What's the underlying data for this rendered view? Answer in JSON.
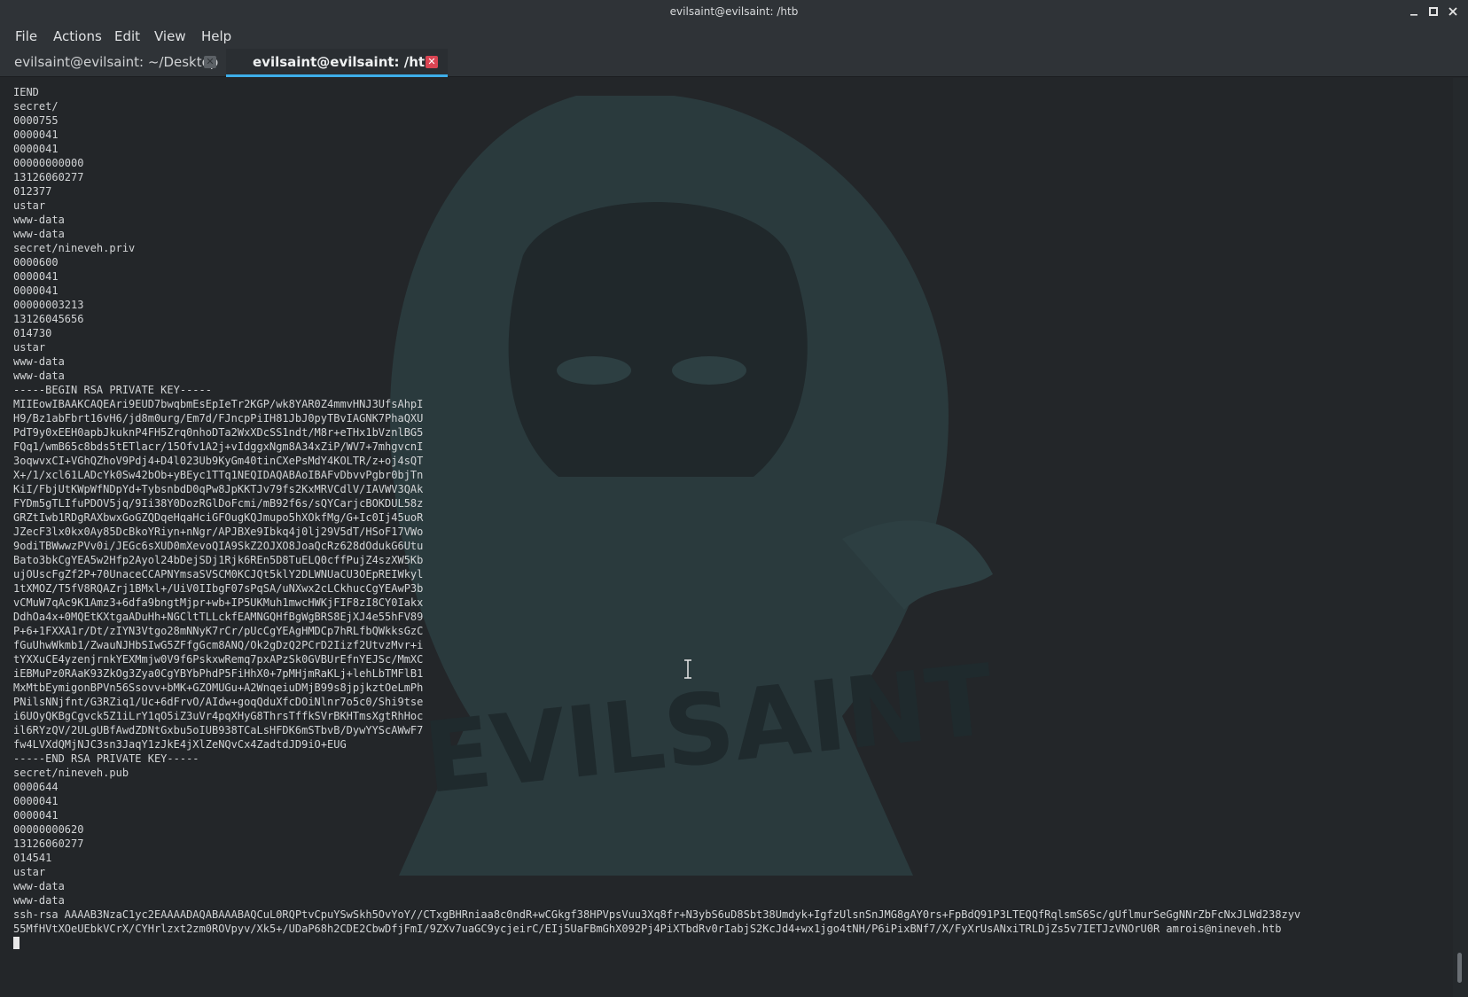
{
  "window": {
    "title": "evilsaint@evilsaint: /htb"
  },
  "menu": [
    "File",
    "Actions",
    "Edit",
    "View",
    "Help"
  ],
  "tabs": [
    {
      "label": "evilsaint@evilsaint: ~/Desktop",
      "close": "✕"
    },
    {
      "label": "evilsaint@evilsaint: /htb",
      "close": "✕"
    }
  ],
  "icons": {
    "minimize": "minimize-icon",
    "maximize": "maximize-icon",
    "close": "close-icon",
    "text_cursor": "text-cursor-icon"
  },
  "colors": {
    "background": "#232629",
    "active_tab_accent": "#3daee9",
    "active_tab_close": "#da4453"
  },
  "watermark": {
    "text": "EVILSAINT"
  },
  "terminal": {
    "lines": [
      "IEND",
      "secret/",
      "0000755",
      "0000041",
      "0000041",
      "00000000000",
      "13126060277",
      "012377",
      "ustar",
      "www-data",
      "www-data",
      "secret/nineveh.priv",
      "0000600",
      "0000041",
      "0000041",
      "00000003213",
      "13126045656",
      "014730",
      "ustar",
      "www-data",
      "www-data",
      "-----BEGIN RSA PRIVATE KEY-----",
      "MIIEowIBAAKCAQEAri9EUD7bwqbmEsEpIeTr2KGP/wk8YAR0Z4mmvHNJ3UfsAhpI",
      "H9/Bz1abFbrt16vH6/jd8m0urg/Em7d/FJncpPiIH81JbJ0pyTBvIAGNK7PhaQXU",
      "PdT9y0xEEH0apbJkuknP4FH5Zrq0nhoDTa2WxXDcSS1ndt/M8r+eTHx1bVznlBG5",
      "FQq1/wmB65c8bds5tETlacr/15Ofv1A2j+vIdggxNgm8A34xZiP/WV7+7mhgvcnI",
      "3oqwvxCI+VGhQZhoV9Pdj4+D4l023Ub9KyGm40tinCXePsMdY4KOLTR/z+oj4sQT",
      "X+/1/xcl61LADcYk0Sw42bOb+yBEyc1TTq1NEQIDAQABAoIBAFvDbvvPgbr0bjTn",
      "KiI/FbjUtKWpWfNDpYd+TybsnbdD0qPw8JpKKTJv79fs2KxMRVCdlV/IAVWV3QAk",
      "FYDm5gTLIfuPDOV5jq/9Ii38Y0DozRGlDoFcmi/mB92f6s/sQYCarjcBOKDUL58z",
      "GRZtIwb1RDgRAXbwxGoGZQDqeHqaHciGFOugKQJmupo5hXOkfMg/G+Ic0Ij45uoR",
      "JZecF3lx0kx0Ay85DcBkoYRiyn+nNgr/APJBXe9Ibkq4j0lj29V5dT/HSoF17VWo",
      "9odiTBWwwzPVv0i/JEGc6sXUD0mXevoQIA9SkZ2OJXO8JoaQcRz628dOdukG6Utu",
      "Bato3bkCgYEA5w2Hfp2Ayol24bDejSDj1Rjk6REn5D8TuELQ0cffPujZ4szXW5Kb",
      "ujOUscFgZf2P+70UnaceCCAPNYmsaSVSCM0KCJQt5klY2DLWNUaCU3OEpREIWkyl",
      "1tXMOZ/T5fV8RQAZrj1BMxl+/UiV0IIbgF07sPqSA/uNXwx2cLCkhucCgYEAwP3b",
      "vCMuW7qAc9K1Amz3+6dfa9bngtMjpr+wb+IP5UKMuh1mwcHWKjFIF8zI8CY0Iakx",
      "DdhOa4x+0MQEtKXtgaADuHh+NGCltTLLckfEAMNGQHfBgWgBRS8EjXJ4e55hFV89",
      "P+6+1FXXA1r/Dt/zIYN3Vtgo28mNNyK7rCr/pUcCgYEAgHMDCp7hRLfbQWkksGzC",
      "fGuUhwWkmb1/ZwauNJHbSIwG5ZFfgGcm8ANQ/Ok2gDzQ2PCrD2Iizf2UtvzMvr+i",
      "tYXXuCE4yzenjrnkYEXMmjw0V9f6PskxwRemq7pxAPzSk0GVBUrEfnYEJSc/MmXC",
      "iEBMuPz0RAaK93ZkOg3Zya0CgYBYbPhdP5FiHhX0+7pMHjmRaKLj+lehLbTMFlB1",
      "MxMtbEymigonBPVn56Ssovv+bMK+GZOMUGu+A2WnqeiuDMjB99s8jpjkztOeLmPh",
      "PNilsNNjfnt/G3RZiq1/Uc+6dFrvO/AIdw+goqQduXfcDOiNlnr7o5c0/Shi9tse",
      "i6UOyQKBgCgvck5Z1iLrY1qO5iZ3uVr4pqXHyG8ThrsTffkSVrBKHTmsXgtRhHoc",
      "il6RYzQV/2ULgUBfAwdZDNtGxbu5oIUB938TCaLsHFDK6mSTbvB/DywYYScAWwF7",
      "fw4LVXdQMjNJC3sn3JaqY1zJkE4jXlZeNQvCx4ZadtdJD9iO+EUG",
      "-----END RSA PRIVATE KEY-----",
      "secret/nineveh.pub",
      "0000644",
      "0000041",
      "0000041",
      "00000000620",
      "13126060277",
      "014541",
      "ustar",
      "www-data",
      "www-data",
      "ssh-rsa AAAAB3NzaC1yc2EAAAADAQABAAABAQCuL0RQPtvCpuYSwSkh5OvYoY//CTxgBHRniaa8c0ndR+wCGkgf38HPVpsVuu3Xq8fr+N3ybS6uD8Sbt38Umdyk+IgfzUlsnSnJMG8gAY0rs+FpBdQ91P3LTEQQfRqlsmS6Sc/gUflmurSeGgNNrZbFcNxJLWd238zyv",
      "55MfHVtXOeUEbkVCrX/CYHrlzxt2zm0ROVpyv/Xk5+/UDaP68h2CDE2CbwDfjFmI/9ZXv7uaGC9ycjeirC/EIj5UaFBmGhX092Pj4PiXTbdRv0rIabjS2KcJd4+wx1jgo4tNH/P6iPixBNf7/X/FyXrUsANxiTRLDjZs5v7IETJzVNOrU0R amrois@nineveh.htb"
    ]
  }
}
